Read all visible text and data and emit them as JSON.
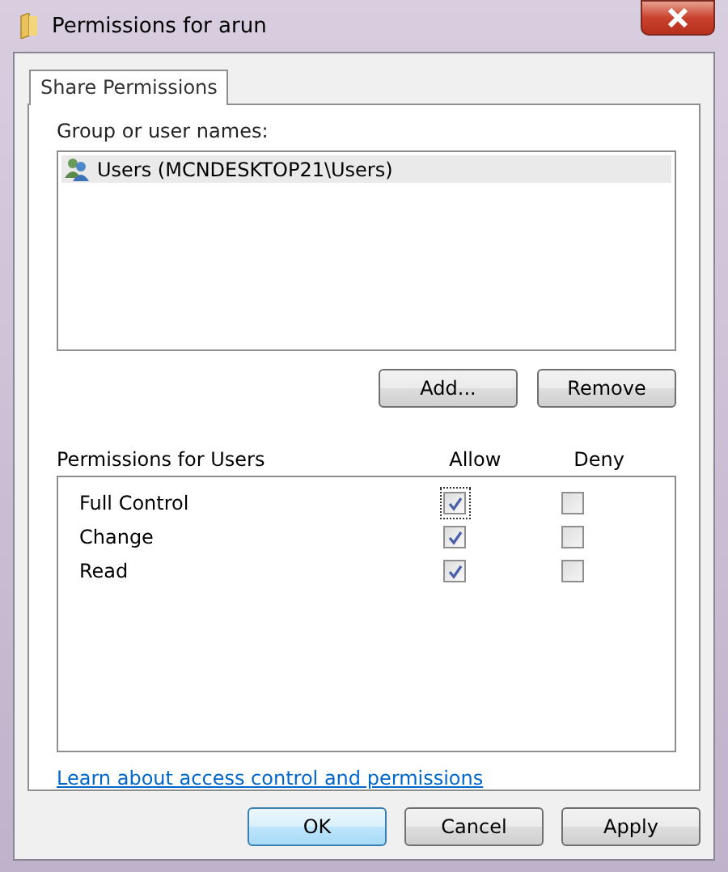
{
  "window": {
    "title": "Permissions for arun"
  },
  "tabs": [
    {
      "label": "Share Permissions",
      "selected": true
    }
  ],
  "group_label": "Group or user names:",
  "users": [
    {
      "name": "Users (MCNDESKTOP21\\Users)",
      "selected": true
    }
  ],
  "user_buttons": [
    "Add...",
    "Remove"
  ],
  "permissions": {
    "label": "Permissions for Users",
    "columns": [
      "Allow",
      "Deny"
    ],
    "rows": [
      {
        "name": "Full Control",
        "allow": true,
        "deny": false,
        "focused": true
      },
      {
        "name": "Change",
        "allow": true,
        "deny": false,
        "focused": false
      },
      {
        "name": "Read",
        "allow": true,
        "deny": false,
        "focused": false
      }
    ]
  },
  "link": "Learn about access control and permissions",
  "buttons": [
    {
      "label": "OK",
      "default": true
    },
    {
      "label": "Cancel",
      "default": false
    },
    {
      "label": "Apply",
      "default": false
    }
  ]
}
